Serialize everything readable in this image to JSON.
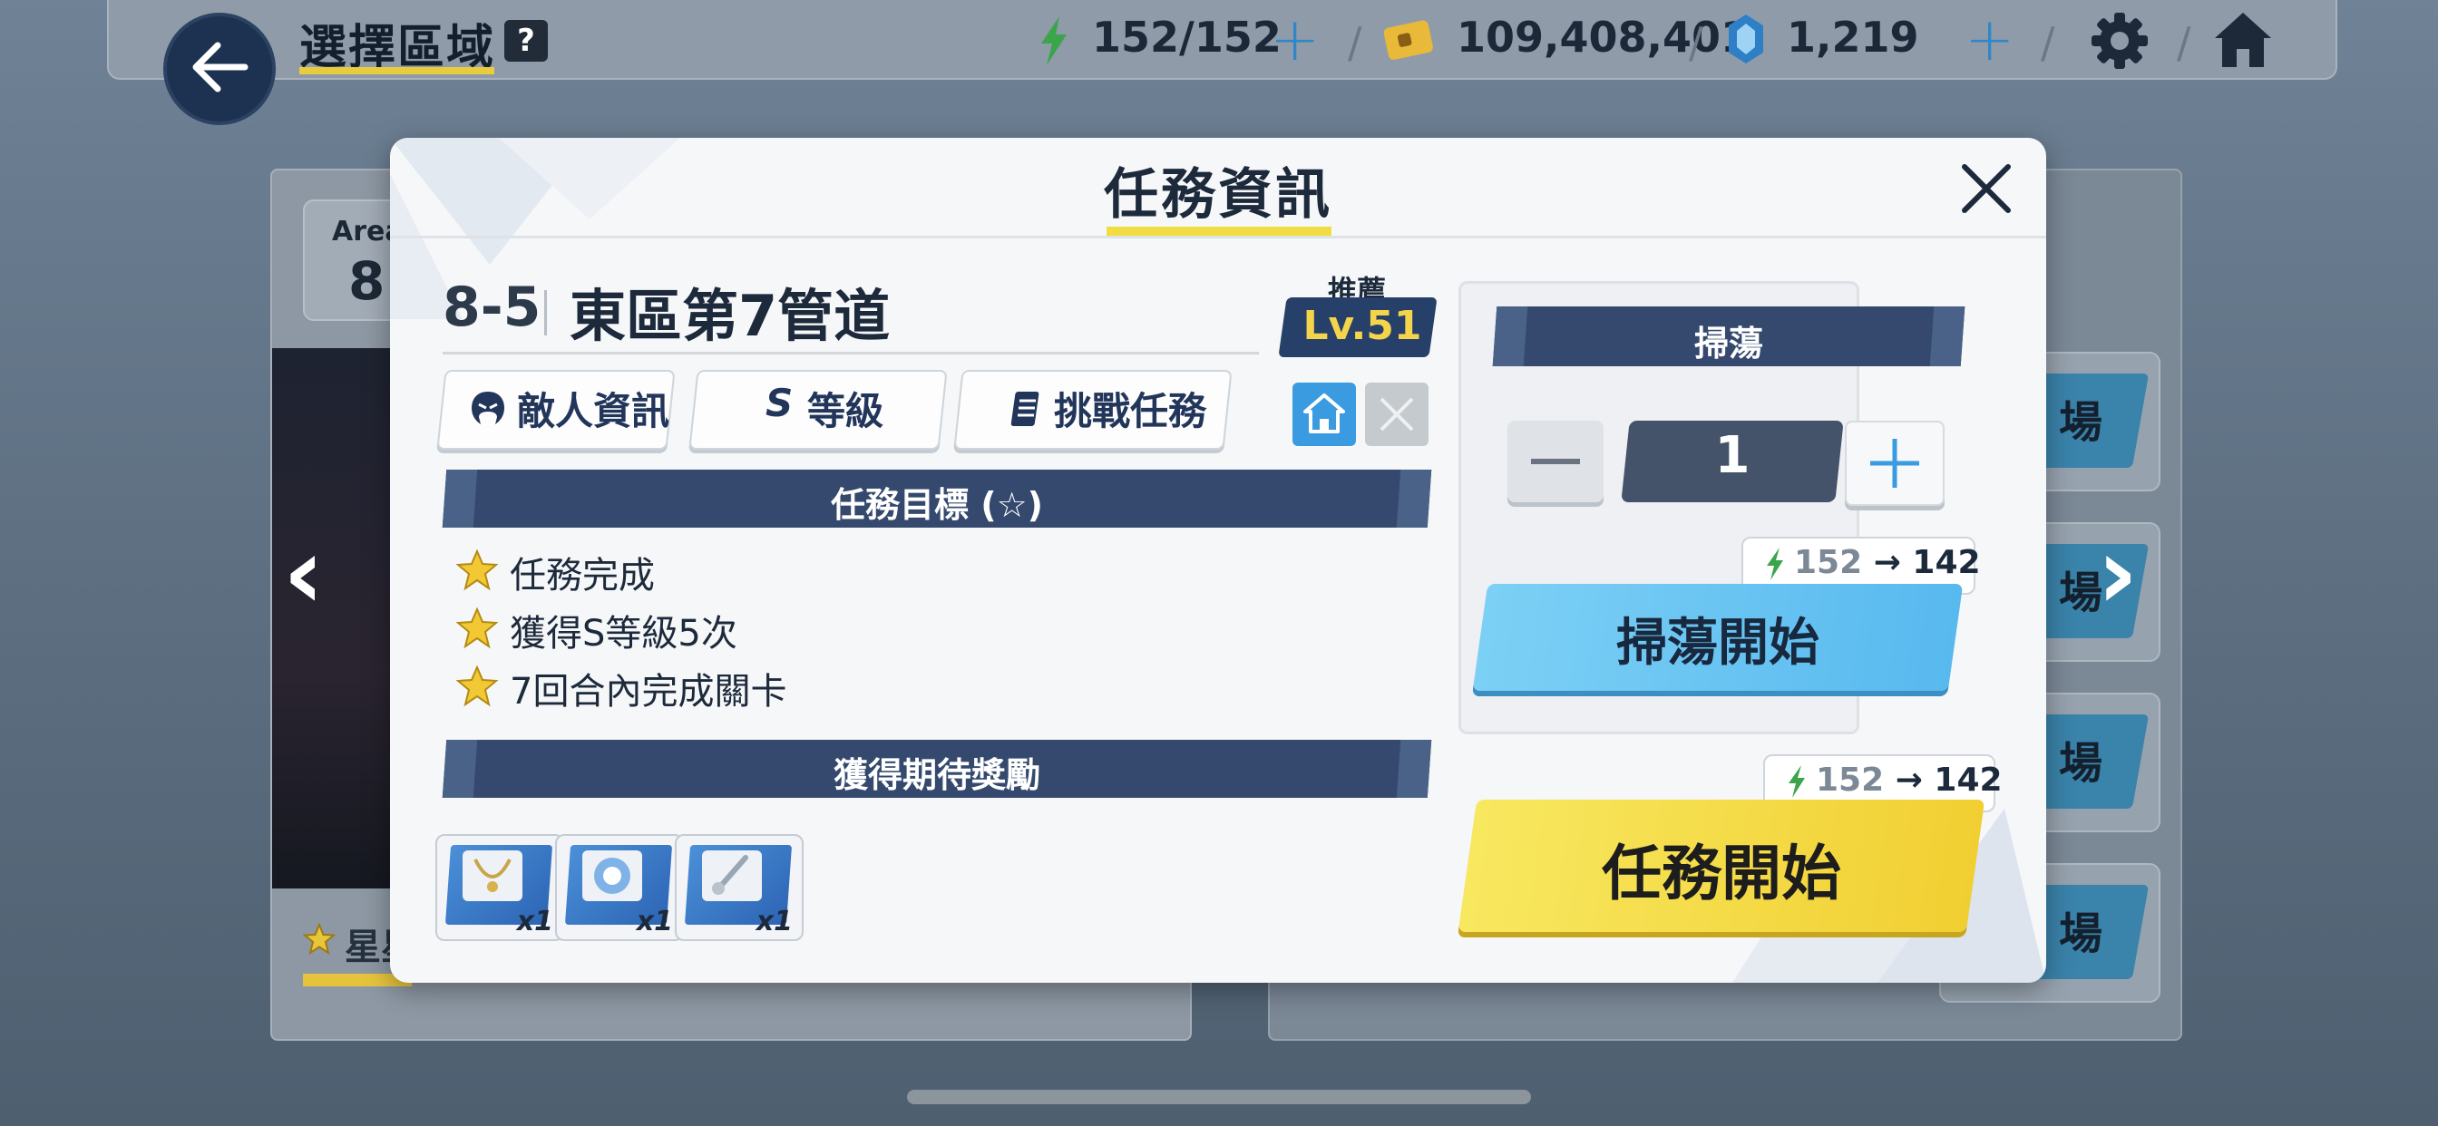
{
  "topbar": {
    "title": "選擇區域",
    "help": "?",
    "stamina": "152/152",
    "credits": "109,408,401",
    "gems": "1,219"
  },
  "background": {
    "area_label": "Area",
    "area_number": "8",
    "star_label": "星星",
    "right_buttons": [
      "場",
      "場",
      "場",
      "場"
    ]
  },
  "modal": {
    "title": "任務資訊",
    "stage_id": "8-5",
    "stage_name": "東區第7管道",
    "recommend_label": "推薦",
    "recommend_level": "Lv.51",
    "tabs": {
      "enemy_info": "敵人資訊",
      "rank_icon": "S",
      "rank": "等級",
      "challenge": "挑戰任務"
    },
    "goals_title": "任務目標 (☆)",
    "goals": [
      "任務完成",
      "獲得S等級5次",
      "7回合內完成關卡"
    ],
    "rewards_title": "獲得期待獎勵",
    "rewards": [
      {
        "item": "necklace",
        "count": "x1"
      },
      {
        "item": "badge",
        "count": "x1"
      },
      {
        "item": "charm",
        "count": "x1"
      }
    ],
    "sweep": {
      "title": "掃蕩",
      "quantity": "1",
      "minus": "−",
      "plus": "+",
      "ap_from": "152",
      "ap_arrow": "→",
      "ap_to": "142",
      "start_label": "掃蕩開始"
    },
    "mission": {
      "ap_from": "152",
      "ap_arrow": "→",
      "ap_to": "142",
      "start_label": "任務開始"
    }
  },
  "colors": {
    "accent_yellow": "#f1dd41",
    "banner_navy": "#34496d",
    "sweep_blue": "#58b9ef",
    "start_yellow": "#f1cf32"
  }
}
